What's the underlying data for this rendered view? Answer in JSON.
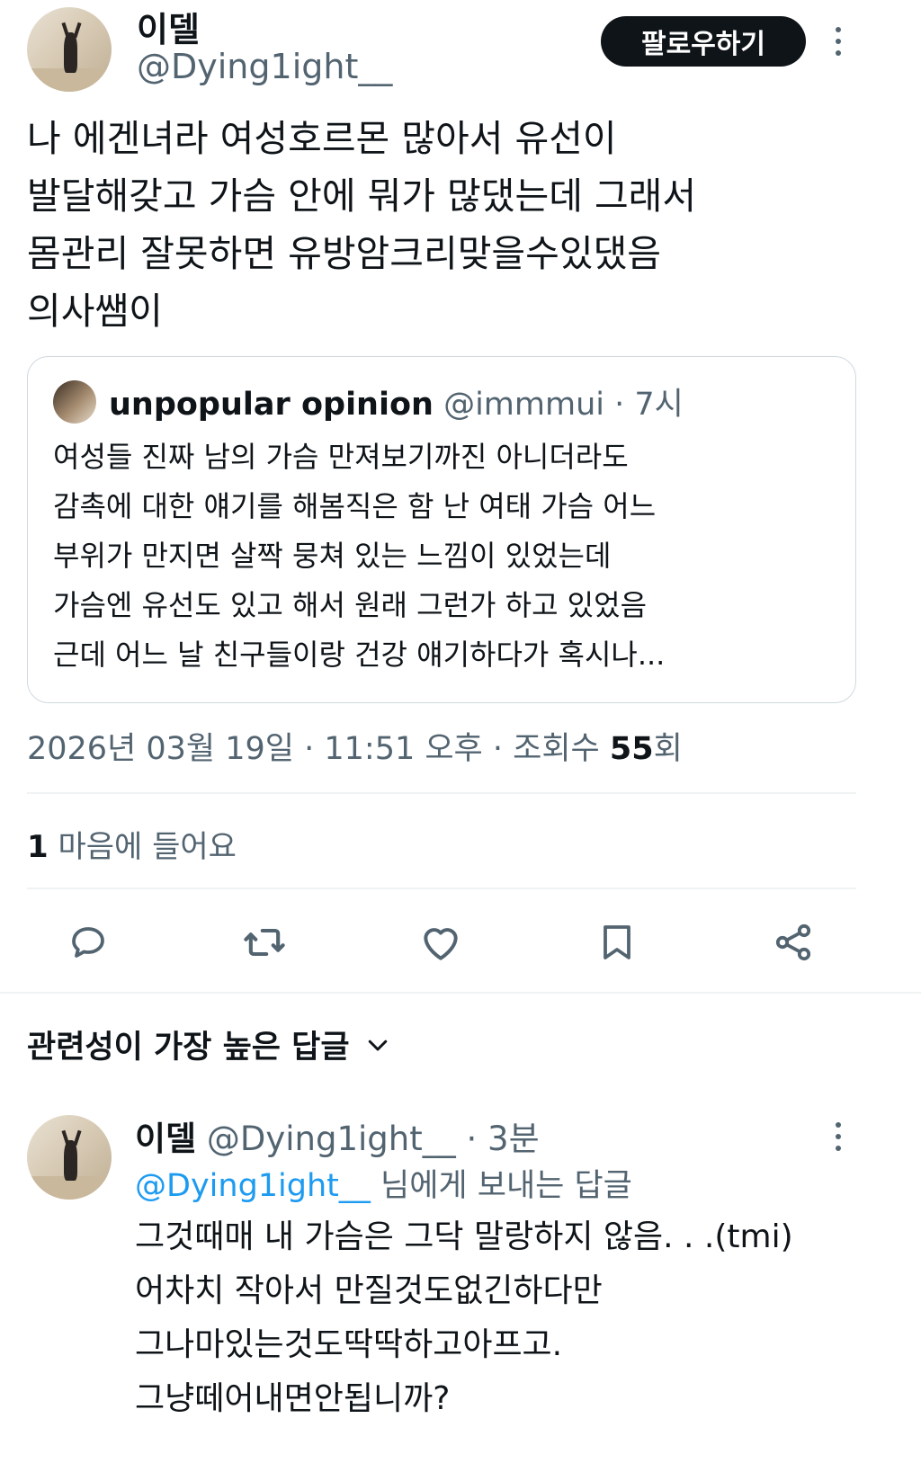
{
  "tweet": {
    "author_name": "이델",
    "author_handle": "@Dying1ight__",
    "follow_label": "팔로우하기",
    "text_lines": [
      "나 에겐녀라 여성호르몬 많아서 유선이",
      "발달해갖고 가슴 안에 뭐가 많댔는데 그래서",
      "몸관리 잘못하면 유방암크리맞을수있댔음",
      "의사쌤이"
    ]
  },
  "quote": {
    "name": "unpopular opinion",
    "handle": "@immmui",
    "time": "· 7시",
    "text_lines": [
      "여성들 진짜 남의 가슴 만져보기까진 아니더라도",
      "감촉에 대한 얘기를 해봄직은 함 난 여태 가슴 어느",
      "부위가 만지면 살짝 뭉쳐 있는 느낌이 있었는데",
      "가슴엔 유선도 있고 해서 원래 그런가 하고 있었음",
      "근데 어느 날 친구들이랑 건강 얘기하다가 혹시나..."
    ]
  },
  "meta": {
    "datetime": "2026년 03월 19일 · 11:51 오후 · 조회수 ",
    "views": "55",
    "views_suffix": "회"
  },
  "likes": {
    "count": "1",
    "label": " 마음에 들어요"
  },
  "actions": {
    "reply_icon": "reply-icon",
    "retweet_icon": "retweet-icon",
    "like_icon": "heart-icon",
    "bookmark_icon": "bookmark-icon",
    "share_icon": "share-icon"
  },
  "replies_section": {
    "title": "관련성이 가장 높은 답글"
  },
  "reply": {
    "author_name": "이델",
    "author_handle": "@Dying1ight__",
    "time": "· 3분",
    "reply_to_mention": "@Dying1ight__",
    "reply_to_suffix": " 님에게 보내는 답글",
    "text_lines": [
      "그것때매 내 가슴은 그닥 말랑하지 않음. . .(tmi)",
      "어차치 작아서 만질것도없긴하다만",
      "그나마있는것도딱딱하고아프고.",
      "그냥떼어내면안됩니까?"
    ]
  },
  "colors": {
    "text": "#0f1419",
    "secondary": "#536471",
    "accent": "#1d9bf0",
    "border": "#cfd9de"
  }
}
